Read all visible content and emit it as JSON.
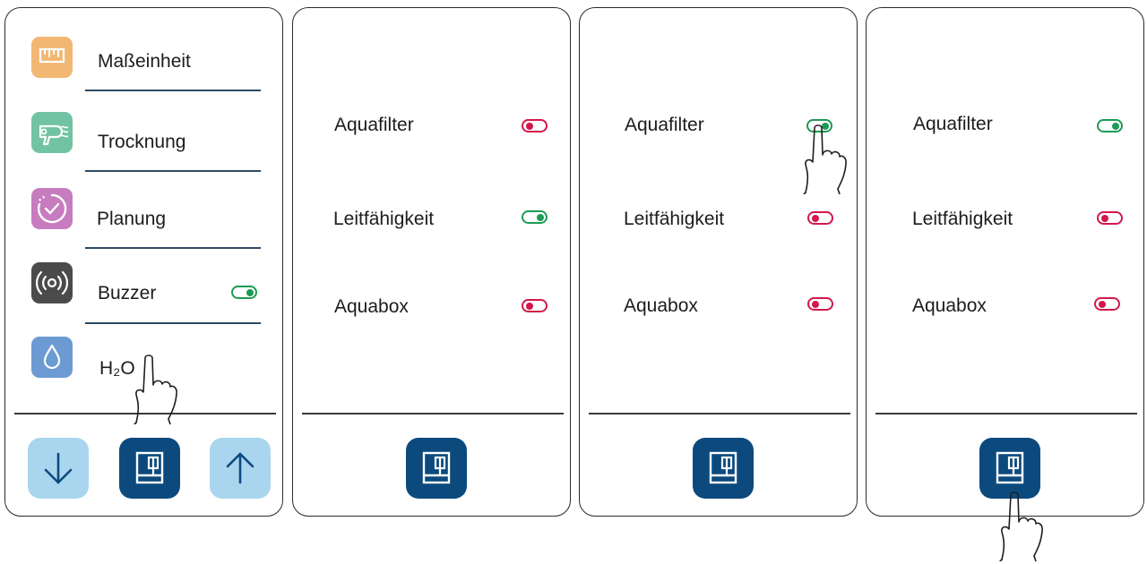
{
  "menu": {
    "items": [
      {
        "label": "Maßeinheit",
        "icon": "ruler-icon",
        "color": "#f2b873"
      },
      {
        "label": "Trocknung",
        "icon": "hair-dryer-icon",
        "color": "#72c2a4"
      },
      {
        "label": "Planung",
        "icon": "timer-clock-icon",
        "color": "#c77cbf"
      },
      {
        "label": "Buzzer",
        "icon": "buzzer-sound-icon",
        "color": "#4b4b4b",
        "toggle": "on"
      },
      {
        "label": "H₂O",
        "icon": "water-drop-icon",
        "color": "#6c9bd3"
      }
    ],
    "nav": {
      "down_icon": "arrow-down-icon",
      "home_icon": "home-screen-icon",
      "up_icon": "arrow-up-icon"
    }
  },
  "screens": [
    {
      "settings": [
        {
          "label": "Aquafilter",
          "state": "off"
        },
        {
          "label": "Leitfähigkeit",
          "state": "on"
        },
        {
          "label": "Aquabox",
          "state": "off"
        }
      ]
    },
    {
      "settings": [
        {
          "label": "Aquafilter",
          "state": "on"
        },
        {
          "label": "Leitfähigkeit",
          "state": "off"
        },
        {
          "label": "Aquabox",
          "state": "off"
        }
      ]
    },
    {
      "settings": [
        {
          "label": "Aquafilter",
          "state": "on"
        },
        {
          "label": "Leitfähigkeit",
          "state": "off"
        },
        {
          "label": "Aquabox",
          "state": "off"
        }
      ]
    }
  ],
  "colors": {
    "toggle_on": "#1d9a55",
    "toggle_off": "#d3174a",
    "button_dark": "#0c4a7e",
    "button_light": "#a9d6ee"
  }
}
